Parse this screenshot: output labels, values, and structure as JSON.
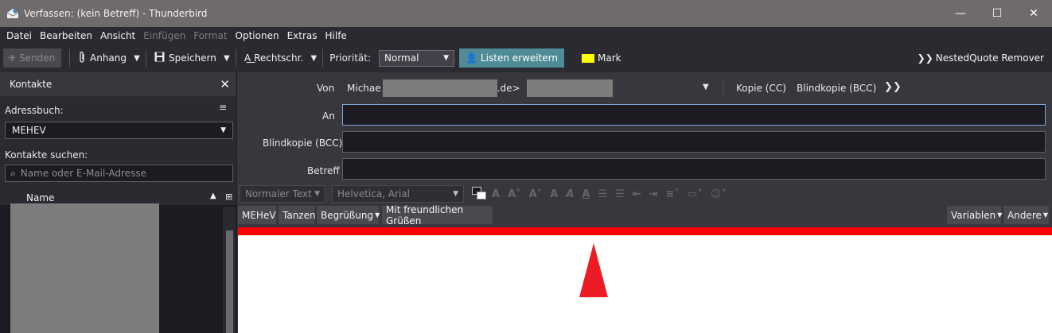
{
  "window": {
    "title": "Verfassen: (kein Betreff) - Thunderbird",
    "minimize": "—",
    "maximize": "☐",
    "close": "✕"
  },
  "menu": [
    {
      "label": "Datei",
      "disabled": false
    },
    {
      "label": "Bearbeiten",
      "disabled": false
    },
    {
      "label": "Ansicht",
      "disabled": false
    },
    {
      "label": "Einfügen",
      "disabled": true
    },
    {
      "label": "Format",
      "disabled": true
    },
    {
      "label": "Optionen",
      "disabled": false
    },
    {
      "label": "Extras",
      "disabled": false
    },
    {
      "label": "Hilfe",
      "disabled": false
    }
  ],
  "toolbar": {
    "send": "Senden",
    "attach": "Anhang",
    "save": "Speichern",
    "spell": "Rechtschr.",
    "priority_label": "Priorität:",
    "priority_value": "Normal",
    "lists": "Listen erweitern",
    "mark": "Mark",
    "nestedquote": "NestedQuote Remover"
  },
  "sidebar": {
    "title": "Kontakte",
    "addressbook_label": "Adressbuch:",
    "addressbook_value": "MEHEV",
    "search_label": "Kontakte suchen:",
    "search_placeholder": "Name oder E-Mail-Adresse",
    "column_name": "Name"
  },
  "compose": {
    "from_label": "Von",
    "from_prefix": "Michae",
    "from_suffix": ".de>",
    "cc": "Kopie (CC)",
    "bcc_link": "Blindkopie (BCC)",
    "to_label": "An",
    "bcc_label": "Blindkopie (BCC)",
    "subject_label": "Betreff"
  },
  "format": {
    "paragraph": "Normaler Text",
    "font": "Helvetica, Arial"
  },
  "quicktext": {
    "b1": "MEHeV",
    "b2": "Tanzen",
    "b3": "Begrüßung",
    "b4": "Mit freundlichen Grüßen",
    "b5": "Variablen",
    "b6": "Andere"
  },
  "colors": {
    "titlebar": "#6f6a6b",
    "accent_lists": "#4f8c95",
    "mark": "#ffff00",
    "red_bar": "#ff0000",
    "triangle": "#ed1c24"
  }
}
